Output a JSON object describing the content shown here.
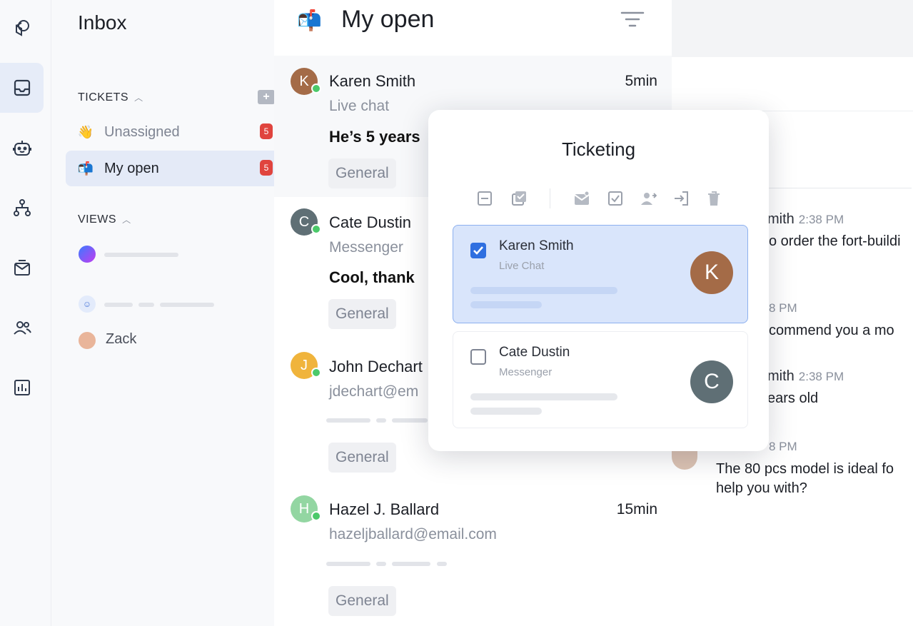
{
  "rail": {
    "items": [
      {
        "icon": "shapes-icon",
        "active": false
      },
      {
        "icon": "inbox-icon",
        "active": true
      },
      {
        "icon": "bot-icon",
        "active": false
      },
      {
        "icon": "workflow-icon",
        "active": false
      },
      {
        "icon": "campaign-icon",
        "active": false
      },
      {
        "icon": "contacts-icon",
        "active": false
      },
      {
        "icon": "analytics-icon",
        "active": false
      }
    ]
  },
  "sidebar": {
    "title": "Inbox",
    "tickets_label": "TICKETS",
    "views_label": "VIEWS",
    "items": [
      {
        "label": "Unassigned",
        "emoji": "👋",
        "badge": "5"
      },
      {
        "label": "My open",
        "emoji": "📬",
        "badge": "5"
      }
    ],
    "views": [
      {
        "label": "Zack"
      }
    ]
  },
  "list": {
    "title": "My open",
    "emoji": "📬",
    "rows": [
      {
        "initial": "K",
        "name": "Karen Smith",
        "sub": "Live chat",
        "message": "He’s 5 years",
        "time": "5min",
        "tag": "General",
        "color": "#a46b47"
      },
      {
        "initial": "C",
        "name": "Cate Dustin",
        "sub": "Messenger",
        "message": "Cool, thank",
        "time": "",
        "tag": "General",
        "color": "#5f6f75"
      },
      {
        "initial": "J",
        "name": "John Dechart",
        "sub": "jdechart@em",
        "message": "",
        "time": "",
        "tag": "General",
        "color": "#f0b43c"
      },
      {
        "initial": "H",
        "name": "Hazel J. Ballard",
        "sub": "hazeljballard@email.com",
        "message": "",
        "time": "15min",
        "tag": "General",
        "color": "#93d6a2"
      }
    ]
  },
  "conversation": {
    "messages": [
      {
        "meta_name": "mith",
        "meta_time": "2:38 PM",
        "text": "o order the fort-buildi"
      },
      {
        "meta_name": "",
        "meta_time": "8 PM",
        "text": "commend you a mo"
      },
      {
        "meta_name": "mith",
        "meta_time": "2:38 PM",
        "text": "ears old"
      },
      {
        "meta_name": "",
        "meta_time": "8 PM",
        "text": "The 80 pcs model is ideal fo",
        "text2": "help you with?"
      }
    ]
  },
  "modal": {
    "title": "Ticketing",
    "toolbar": [
      "minus-square-icon",
      "select-all-icon",
      "mark-read-icon",
      "resolve-icon",
      "assign-icon",
      "move-icon",
      "trash-icon"
    ],
    "cards": [
      {
        "name": "Karen Smith",
        "sub": "Live Chat",
        "initial": "K",
        "checked": true,
        "color": "#a46b47"
      },
      {
        "name": "Cate Dustin",
        "sub": "Messenger",
        "initial": "C",
        "checked": false,
        "color": "#5f6f75"
      }
    ]
  },
  "colors": {
    "accent": "#2f6fe0",
    "badge": "#e0443e",
    "online": "#4bc96a"
  }
}
